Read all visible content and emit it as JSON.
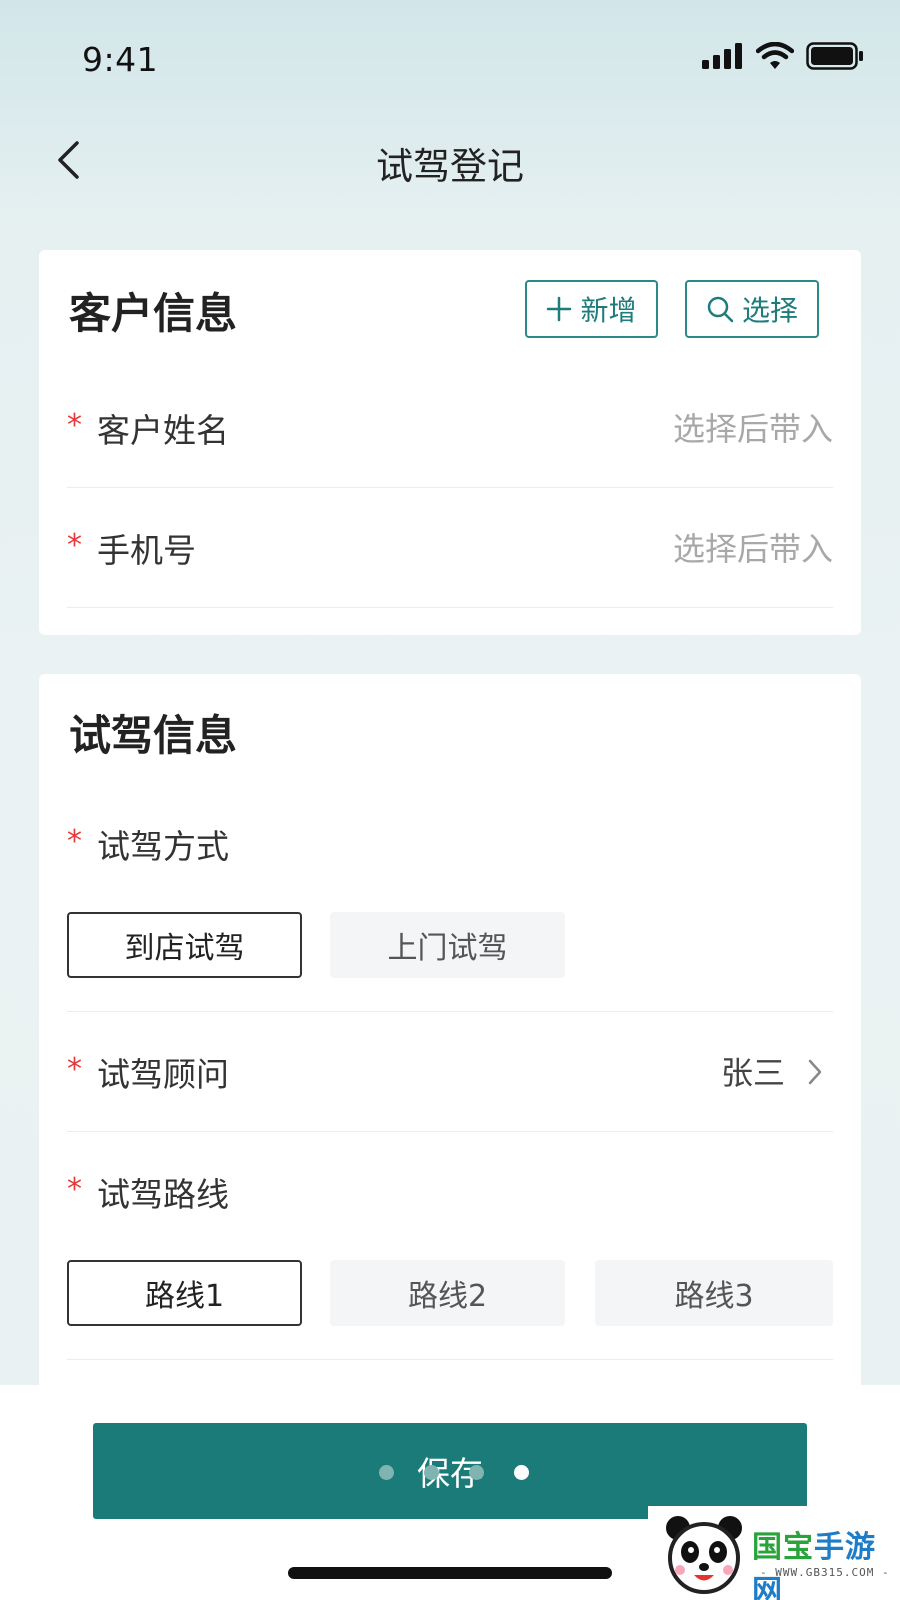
{
  "status_bar": {
    "time": "9:41"
  },
  "nav": {
    "title": "试驾登记"
  },
  "customer_section": {
    "title": "客户信息",
    "add_label": "新增",
    "select_label": "选择",
    "fields": [
      {
        "label": "客户姓名",
        "value": "选择后带入",
        "required": "*"
      },
      {
        "label": "手机号",
        "value": "选择后带入",
        "required": "*"
      }
    ]
  },
  "drive_section": {
    "title": "试驾信息",
    "mode": {
      "label": "试驾方式",
      "required": "*",
      "options": [
        "到店试驾",
        "上门试驾"
      ],
      "selected": "到店试驾"
    },
    "advisor": {
      "label": "试驾顾问",
      "required": "*",
      "value": "张三"
    },
    "route": {
      "label": "试驾路线",
      "required": "*",
      "options": [
        "路线1",
        "路线2",
        "路线3"
      ],
      "selected": "路线1"
    }
  },
  "footer": {
    "save_label": "保存"
  },
  "watermark": {
    "brand_1": "国宝",
    "brand_2": "手游网",
    "url": "- WWW.GB315.COM -"
  },
  "colors": {
    "accent": "#1b7b79",
    "required": "#e23a3a",
    "placeholder": "#a8a8a8"
  },
  "icons": [
    "signal-icon",
    "wifi-icon",
    "battery-icon",
    "back-arrow-icon",
    "plus-icon",
    "search-icon",
    "chevron-right-icon",
    "panda-logo-icon"
  ]
}
